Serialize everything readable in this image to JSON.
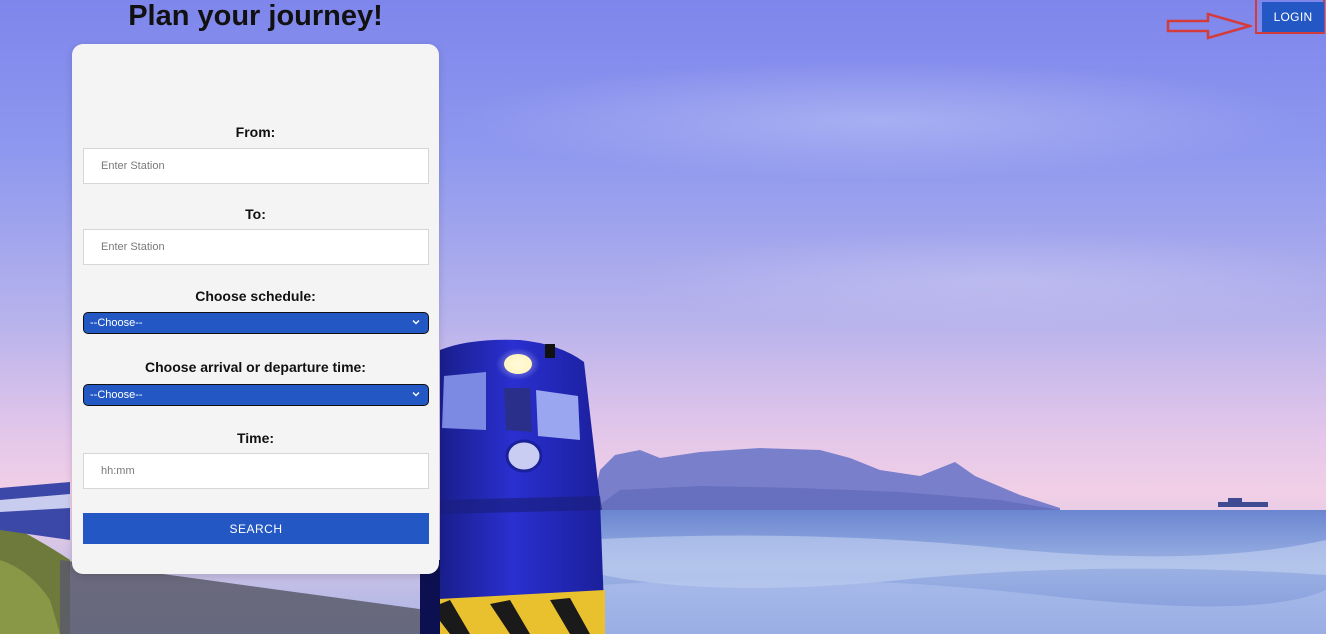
{
  "header": {
    "login_label": "LOGIN"
  },
  "journey_form": {
    "title": "Plan your journey!",
    "from": {
      "label": "From:",
      "placeholder": "Enter Station",
      "value": ""
    },
    "to": {
      "label": "To:",
      "placeholder": "Enter Station",
      "value": ""
    },
    "schedule": {
      "label": "Choose schedule:",
      "selected": "--Choose--"
    },
    "time_type": {
      "label": "Choose arrival or departure time:",
      "selected": "--Choose--"
    },
    "time": {
      "label": "Time:",
      "placeholder": "hh:mm",
      "value": ""
    },
    "search_label": "SEARCH"
  },
  "colors": {
    "accent": "#2358c4",
    "annotation": "#d43c3c",
    "card_background": "#f4f4f4"
  },
  "icons": {
    "dropdown": "chevron-down-icon",
    "annotation": "arrow-right-icon"
  }
}
